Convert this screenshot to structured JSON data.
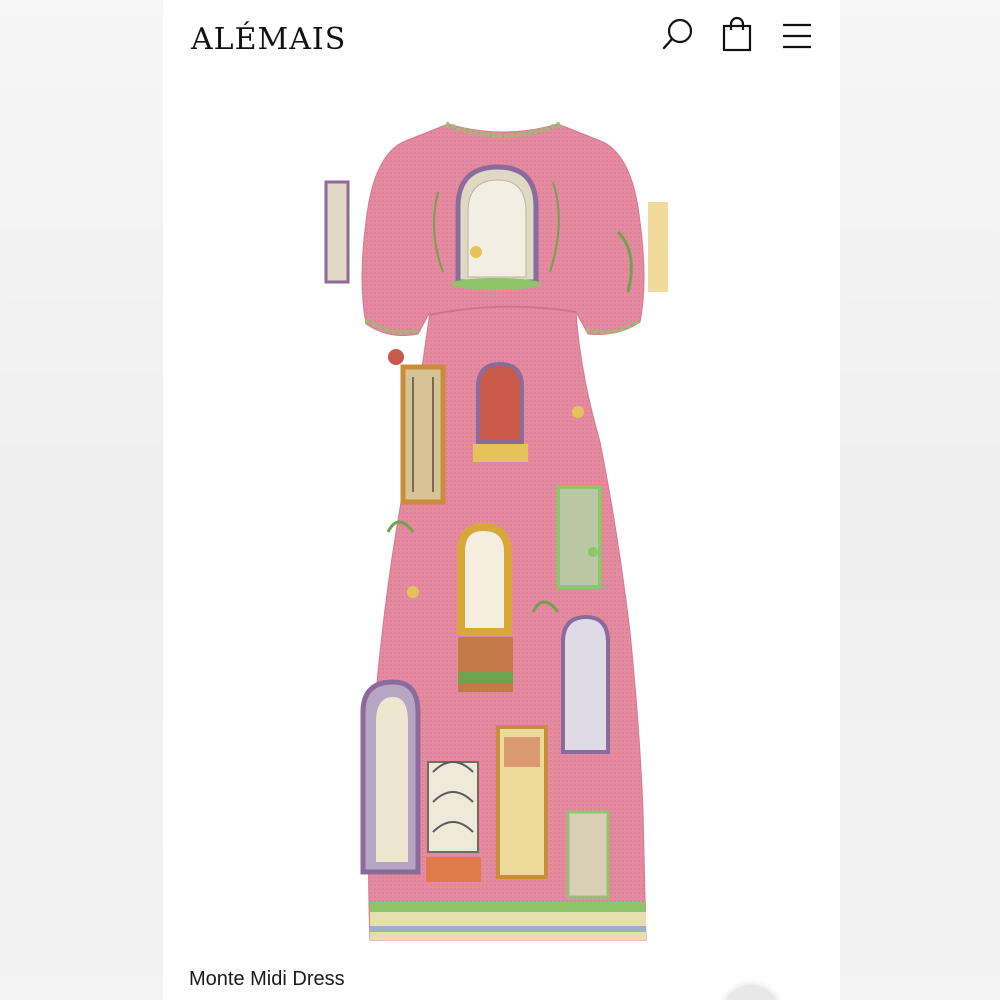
{
  "header": {
    "brand": "ALÉMAIS",
    "icons": [
      "search-icon",
      "shopping-bag-icon",
      "menu-icon"
    ]
  },
  "product": {
    "name": "Monte Midi Dress",
    "image": {
      "description_icon": "dress-image",
      "primary_color": "#e2899f",
      "accent_colors": [
        "#8fc46a",
        "#e6c35a",
        "#8b6a9c",
        "#c95a4a",
        "#ded8c4"
      ]
    }
  }
}
